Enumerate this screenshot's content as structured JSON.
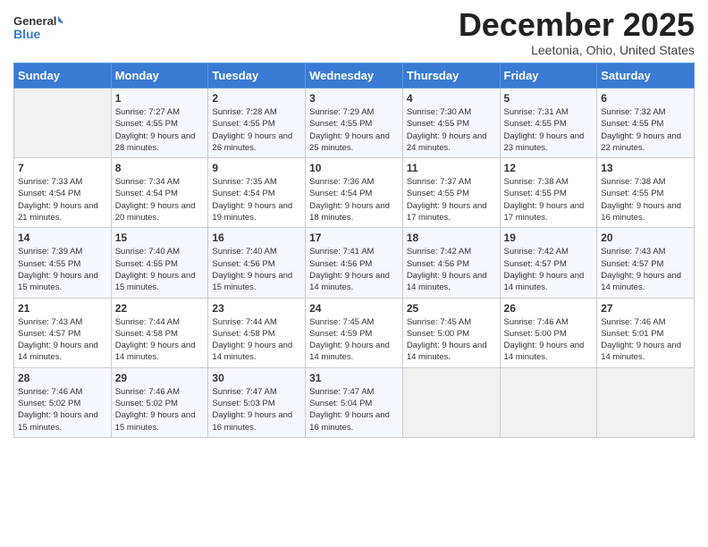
{
  "header": {
    "logo_general": "General",
    "logo_blue": "Blue",
    "title": "December 2025",
    "subtitle": "Leetonia, Ohio, United States"
  },
  "days_of_week": [
    "Sunday",
    "Monday",
    "Tuesday",
    "Wednesday",
    "Thursday",
    "Friday",
    "Saturday"
  ],
  "weeks": [
    [
      {
        "day": "",
        "sunrise": "",
        "sunset": "",
        "daylight": ""
      },
      {
        "day": "1",
        "sunrise": "Sunrise: 7:27 AM",
        "sunset": "Sunset: 4:55 PM",
        "daylight": "Daylight: 9 hours and 28 minutes."
      },
      {
        "day": "2",
        "sunrise": "Sunrise: 7:28 AM",
        "sunset": "Sunset: 4:55 PM",
        "daylight": "Daylight: 9 hours and 26 minutes."
      },
      {
        "day": "3",
        "sunrise": "Sunrise: 7:29 AM",
        "sunset": "Sunset: 4:55 PM",
        "daylight": "Daylight: 9 hours and 25 minutes."
      },
      {
        "day": "4",
        "sunrise": "Sunrise: 7:30 AM",
        "sunset": "Sunset: 4:55 PM",
        "daylight": "Daylight: 9 hours and 24 minutes."
      },
      {
        "day": "5",
        "sunrise": "Sunrise: 7:31 AM",
        "sunset": "Sunset: 4:55 PM",
        "daylight": "Daylight: 9 hours and 23 minutes."
      },
      {
        "day": "6",
        "sunrise": "Sunrise: 7:32 AM",
        "sunset": "Sunset: 4:55 PM",
        "daylight": "Daylight: 9 hours and 22 minutes."
      }
    ],
    [
      {
        "day": "7",
        "sunrise": "Sunrise: 7:33 AM",
        "sunset": "Sunset: 4:54 PM",
        "daylight": "Daylight: 9 hours and 21 minutes."
      },
      {
        "day": "8",
        "sunrise": "Sunrise: 7:34 AM",
        "sunset": "Sunset: 4:54 PM",
        "daylight": "Daylight: 9 hours and 20 minutes."
      },
      {
        "day": "9",
        "sunrise": "Sunrise: 7:35 AM",
        "sunset": "Sunset: 4:54 PM",
        "daylight": "Daylight: 9 hours and 19 minutes."
      },
      {
        "day": "10",
        "sunrise": "Sunrise: 7:36 AM",
        "sunset": "Sunset: 4:54 PM",
        "daylight": "Daylight: 9 hours and 18 minutes."
      },
      {
        "day": "11",
        "sunrise": "Sunrise: 7:37 AM",
        "sunset": "Sunset: 4:55 PM",
        "daylight": "Daylight: 9 hours and 17 minutes."
      },
      {
        "day": "12",
        "sunrise": "Sunrise: 7:38 AM",
        "sunset": "Sunset: 4:55 PM",
        "daylight": "Daylight: 9 hours and 17 minutes."
      },
      {
        "day": "13",
        "sunrise": "Sunrise: 7:38 AM",
        "sunset": "Sunset: 4:55 PM",
        "daylight": "Daylight: 9 hours and 16 minutes."
      }
    ],
    [
      {
        "day": "14",
        "sunrise": "Sunrise: 7:39 AM",
        "sunset": "Sunset: 4:55 PM",
        "daylight": "Daylight: 9 hours and 15 minutes."
      },
      {
        "day": "15",
        "sunrise": "Sunrise: 7:40 AM",
        "sunset": "Sunset: 4:55 PM",
        "daylight": "Daylight: 9 hours and 15 minutes."
      },
      {
        "day": "16",
        "sunrise": "Sunrise: 7:40 AM",
        "sunset": "Sunset: 4:56 PM",
        "daylight": "Daylight: 9 hours and 15 minutes."
      },
      {
        "day": "17",
        "sunrise": "Sunrise: 7:41 AM",
        "sunset": "Sunset: 4:56 PM",
        "daylight": "Daylight: 9 hours and 14 minutes."
      },
      {
        "day": "18",
        "sunrise": "Sunrise: 7:42 AM",
        "sunset": "Sunset: 4:56 PM",
        "daylight": "Daylight: 9 hours and 14 minutes."
      },
      {
        "day": "19",
        "sunrise": "Sunrise: 7:42 AM",
        "sunset": "Sunset: 4:57 PM",
        "daylight": "Daylight: 9 hours and 14 minutes."
      },
      {
        "day": "20",
        "sunrise": "Sunrise: 7:43 AM",
        "sunset": "Sunset: 4:57 PM",
        "daylight": "Daylight: 9 hours and 14 minutes."
      }
    ],
    [
      {
        "day": "21",
        "sunrise": "Sunrise: 7:43 AM",
        "sunset": "Sunset: 4:57 PM",
        "daylight": "Daylight: 9 hours and 14 minutes."
      },
      {
        "day": "22",
        "sunrise": "Sunrise: 7:44 AM",
        "sunset": "Sunset: 4:58 PM",
        "daylight": "Daylight: 9 hours and 14 minutes."
      },
      {
        "day": "23",
        "sunrise": "Sunrise: 7:44 AM",
        "sunset": "Sunset: 4:58 PM",
        "daylight": "Daylight: 9 hours and 14 minutes."
      },
      {
        "day": "24",
        "sunrise": "Sunrise: 7:45 AM",
        "sunset": "Sunset: 4:59 PM",
        "daylight": "Daylight: 9 hours and 14 minutes."
      },
      {
        "day": "25",
        "sunrise": "Sunrise: 7:45 AM",
        "sunset": "Sunset: 5:00 PM",
        "daylight": "Daylight: 9 hours and 14 minutes."
      },
      {
        "day": "26",
        "sunrise": "Sunrise: 7:46 AM",
        "sunset": "Sunset: 5:00 PM",
        "daylight": "Daylight: 9 hours and 14 minutes."
      },
      {
        "day": "27",
        "sunrise": "Sunrise: 7:46 AM",
        "sunset": "Sunset: 5:01 PM",
        "daylight": "Daylight: 9 hours and 14 minutes."
      }
    ],
    [
      {
        "day": "28",
        "sunrise": "Sunrise: 7:46 AM",
        "sunset": "Sunset: 5:02 PM",
        "daylight": "Daylight: 9 hours and 15 minutes."
      },
      {
        "day": "29",
        "sunrise": "Sunrise: 7:46 AM",
        "sunset": "Sunset: 5:02 PM",
        "daylight": "Daylight: 9 hours and 15 minutes."
      },
      {
        "day": "30",
        "sunrise": "Sunrise: 7:47 AM",
        "sunset": "Sunset: 5:03 PM",
        "daylight": "Daylight: 9 hours and 16 minutes."
      },
      {
        "day": "31",
        "sunrise": "Sunrise: 7:47 AM",
        "sunset": "Sunset: 5:04 PM",
        "daylight": "Daylight: 9 hours and 16 minutes."
      },
      {
        "day": "",
        "sunrise": "",
        "sunset": "",
        "daylight": ""
      },
      {
        "day": "",
        "sunrise": "",
        "sunset": "",
        "daylight": ""
      },
      {
        "day": "",
        "sunrise": "",
        "sunset": "",
        "daylight": ""
      }
    ]
  ]
}
